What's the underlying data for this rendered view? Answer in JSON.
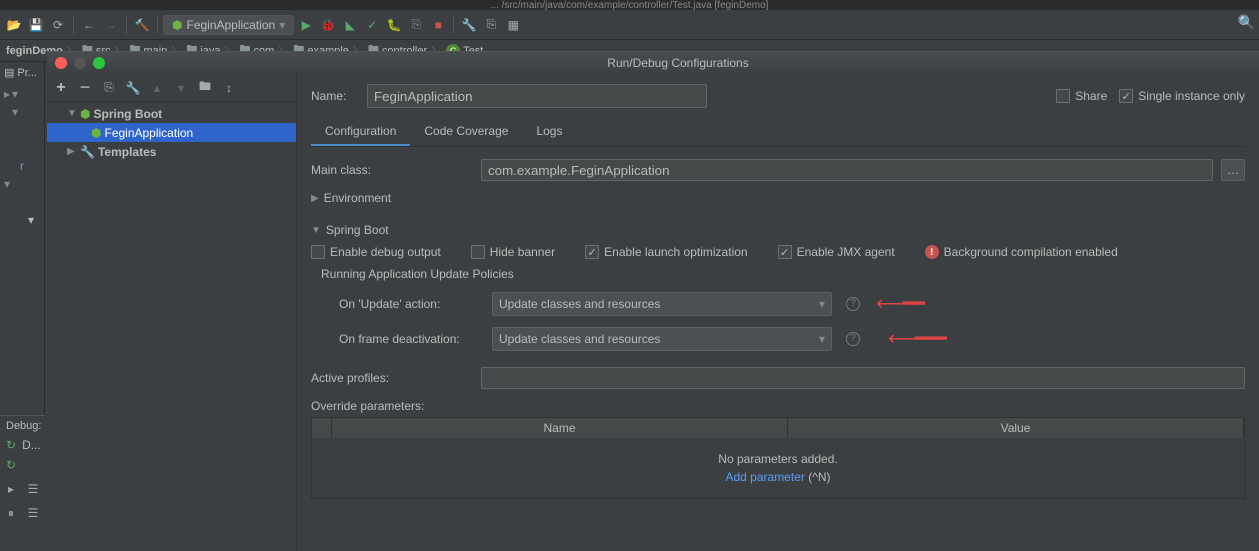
{
  "top_path": "... /src/main/java/com/example/controller/Test.java [feginDemo]",
  "toolbar": {
    "config_name": "FeginApplication"
  },
  "breadcrumb": {
    "project": "feginDemo",
    "items": [
      "src",
      "main",
      "java",
      "com",
      "example",
      "controller",
      "Test"
    ]
  },
  "project_panel": "Pr...",
  "debug_panel": {
    "label": "Debug:",
    "tab": "D..."
  },
  "dialog": {
    "title": "Run/Debug Configurations",
    "tree": {
      "spring_boot": "Spring Boot",
      "fegin_app": "FeginApplication",
      "templates": "Templates"
    },
    "form": {
      "name_label": "Name:",
      "name_value": "FeginApplication",
      "share_label": "Share",
      "single_instance_label": "Single instance only",
      "tabs": {
        "configuration": "Configuration",
        "coverage": "Code Coverage",
        "logs": "Logs"
      },
      "main_class_label": "Main class:",
      "main_class_value": "com.example.FeginApplication",
      "environment": "Environment",
      "spring_boot": "Spring Boot",
      "enable_debug": "Enable debug output",
      "hide_banner": "Hide banner",
      "enable_launch": "Enable launch optimization",
      "enable_jmx": "Enable JMX agent",
      "bg_compile": "Background compilation enabled",
      "update_policies": "Running Application Update Policies",
      "on_update_label": "On 'Update' action:",
      "on_update_value": "Update classes and resources",
      "on_frame_label": "On frame deactivation:",
      "on_frame_value": "Update classes and resources",
      "active_profiles_label": "Active profiles:",
      "override_params_label": "Override parameters:",
      "param_name_col": "Name",
      "param_value_col": "Value",
      "no_params": "No parameters added.",
      "add_param": "Add parameter",
      "add_param_shortcut": "(^N)"
    }
  }
}
